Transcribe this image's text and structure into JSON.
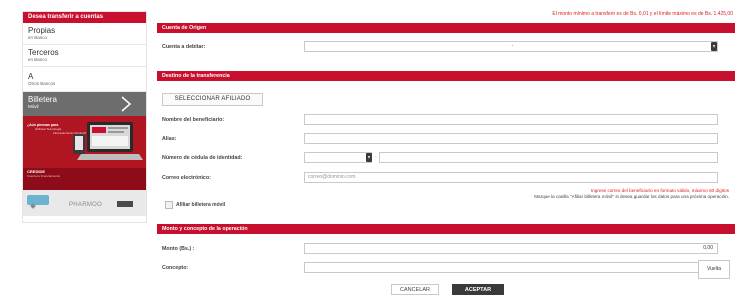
{
  "sidebar": {
    "header": "Desea transferir a cuentas",
    "items": [
      {
        "title": "Propias",
        "subtitle": "en Banco"
      },
      {
        "title": "Terceros",
        "subtitle": "en Banco"
      },
      {
        "title": "A",
        "subtitle": "Otros Bancos"
      },
      {
        "title": "Billetera",
        "subtitle": "Móvil"
      }
    ],
    "promo": {
      "title": "¿Aún piensas para",
      "line1": "disfrutar Tecnología",
      "line2": "Financiamiento Original?",
      "logo": "CREDIDE",
      "logo_sub": "Cuenta tu financiamiento",
      "brand": "PHARMOO"
    }
  },
  "limit_note": "El monto mínimo a transferir es de Bs. 0,01 y el límite máximo es de Bs. 1.425,00",
  "origin": {
    "header": "Cuenta de Origen",
    "debit_label": "Cuenta a debitar:",
    "debit_value": "-"
  },
  "destination": {
    "header": "Destino de la transferencia",
    "select_affiliate": "SELECCIONAR AFILIADO",
    "name_label": "Nombre del beneficiario:",
    "alias_label": "Alias:",
    "id_label": "Número de cédula de identidad:",
    "id_separator": "-",
    "email_label": "Correo electrónico:",
    "email_placeholder": "correo@dominio.com",
    "email_error": "Ingrese correo del beneficiario en formato válido, máximo 60 dígitos",
    "affiliate_hint": "Marque la casilla \"Afiliar billetera móvil\" si desea guardar los datos para una próxima operación.",
    "affiliate_checkbox": "Afiliar billetera móvil"
  },
  "amount": {
    "header": "Monto y concepto de la operación",
    "amount_label": "Monto (Bs.) :",
    "amount_value": "0,00",
    "concept_label": "Concepto:"
  },
  "actions": {
    "cancel": "CANCELAR",
    "accept": "ACEPTAR",
    "back": "Vuelta"
  },
  "colors": {
    "brand_red": "#c8102e",
    "sidebar_active": "#6d6d6d",
    "button_dark": "#3a3a3a",
    "error_red": "#dd2222"
  }
}
